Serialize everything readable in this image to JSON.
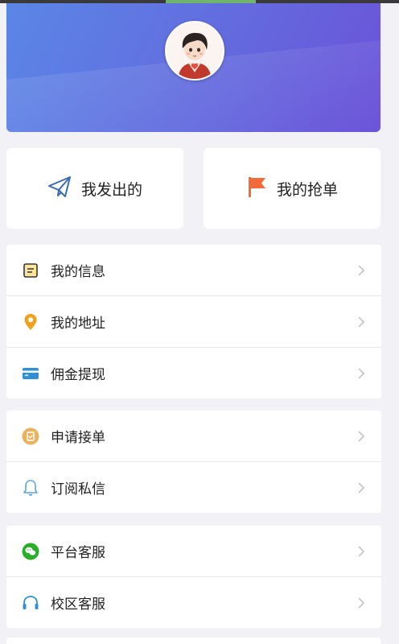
{
  "quick_actions": {
    "sent": "我发出的",
    "grabbed": "我的抢单"
  },
  "menu": {
    "group1": [
      {
        "label": "我的信息",
        "icon": "notepad-icon"
      },
      {
        "label": "我的地址",
        "icon": "location-pin-icon"
      },
      {
        "label": "佣金提现",
        "icon": "card-icon"
      }
    ],
    "group2": [
      {
        "label": "申请接单",
        "icon": "clipboard-check-icon"
      },
      {
        "label": "订阅私信",
        "icon": "bell-icon"
      }
    ],
    "group3": [
      {
        "label": "平台客服",
        "icon": "wechat-icon"
      },
      {
        "label": "校区客服",
        "icon": "headset-icon"
      }
    ]
  },
  "colors": {
    "header_start": "#5a86e6",
    "header_end": "#6b52d8",
    "sent_icon": "#3b6cae",
    "flag_icon": "#f26b3a",
    "pin_icon": "#f0a21c",
    "card_icon": "#2f8fd8",
    "wechat_icon": "#2aae2a",
    "headset_icon": "#2f8fd8"
  }
}
